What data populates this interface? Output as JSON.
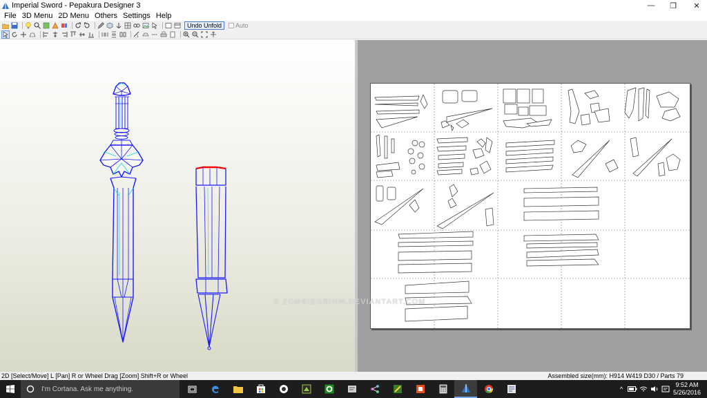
{
  "window": {
    "title": "Imperial Sword - Pepakura Designer 3",
    "minimize_glyph": "—",
    "maximize_glyph": "❐",
    "close_glyph": "✕"
  },
  "menu": [
    "File",
    "3D Menu",
    "2D Menu",
    "Others",
    "Settings",
    "Help"
  ],
  "toolbar": {
    "undo_unfold_label": "Undo Unfold",
    "auto_label": "Auto"
  },
  "watermark": "© ZOMBIEGRIMM.DEVIANTART.COM",
  "status": {
    "help_text": "2D [Select/Move] L [Pan] R or Wheel Drag [Zoom] Shift+R or Wheel",
    "assembled_size": "Assembled size(mm): H914 W419 D30 / Parts 79"
  },
  "taskbar": {
    "search_placeholder": "I'm Cortana. Ask me anything.",
    "apps": [
      "task-view-icon",
      "edge-icon",
      "file-explorer-icon",
      "store-icon",
      "media-icon",
      "game-icon",
      "xbox-icon",
      "app-icon",
      "network-app-icon",
      "paint-icon",
      "office-icon",
      "calculator-icon",
      "pepakura-icon",
      "chrome-icon",
      "settings-app-icon"
    ],
    "time": "9:52 AM",
    "date": "5/26/2016",
    "accent": "#76a9e8"
  },
  "colors": {
    "wire_blue": "#1a1aff",
    "wire_cyan": "#00d8e0",
    "cut_red": "#ff0000",
    "sheet_bg": "#ffffff",
    "pane2d_bg": "#a0a0a0"
  }
}
